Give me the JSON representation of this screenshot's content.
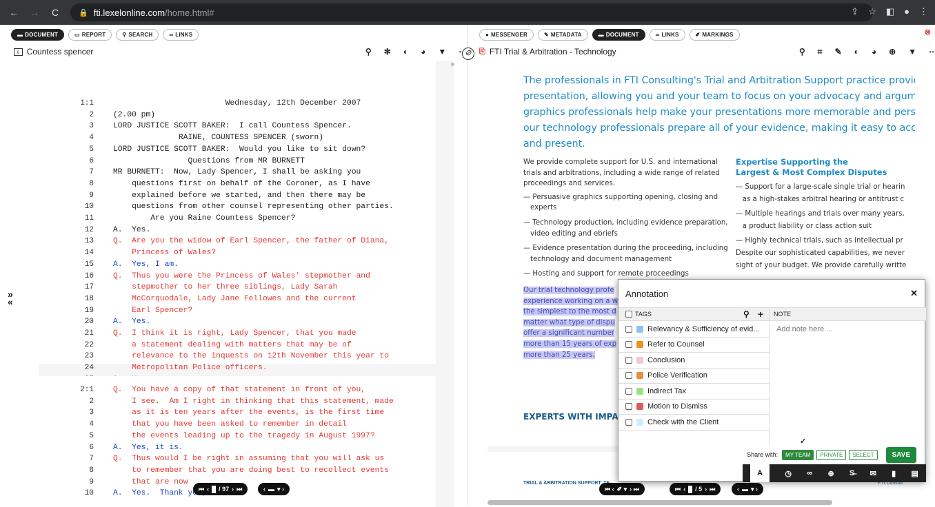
{
  "browser": {
    "url_host": "fti.lexelonline.com",
    "url_path": "/home.html#",
    "back": "←",
    "forward": "→",
    "reload": "C"
  },
  "left": {
    "tabs": [
      {
        "label": "DOCUMENT",
        "icon": "▬"
      },
      {
        "label": "REPORT",
        "icon": "▭"
      },
      {
        "label": "SEARCH",
        "icon": "⚲"
      },
      {
        "label": "LINKS",
        "icon": "∞"
      }
    ],
    "title": "Countess spencer",
    "page1": [
      {
        "n": "1:1",
        "t": "                        Wednesday, 12th December 2007",
        "c": ""
      },
      {
        "n": "2",
        "t": "(2.00 pm)",
        "c": ""
      },
      {
        "n": "3",
        "t": "LORD JUSTICE SCOTT BAKER:  I call Countess Spencer.",
        "c": ""
      },
      {
        "n": "4",
        "t": "              RAINE, COUNTESS SPENCER (sworn)",
        "c": ""
      },
      {
        "n": "5",
        "t": "LORD JUSTICE SCOTT BAKER:  Would you like to sit down?",
        "c": ""
      },
      {
        "n": "6",
        "t": "                Questions from MR BURNETT",
        "c": ""
      },
      {
        "n": "7",
        "t": "MR BURNETT:  Now, Lady Spencer, I shall be asking you",
        "c": ""
      },
      {
        "n": "8",
        "t": "    questions first on behalf of the Coroner, as I have",
        "c": ""
      },
      {
        "n": "9",
        "t": "    explained before we started, and then there may be",
        "c": ""
      },
      {
        "n": "10",
        "t": "    questions from other counsel representing other parties.",
        "c": ""
      },
      {
        "n": "11",
        "t": "        Are you Raine Countess Spencer?",
        "c": ""
      },
      {
        "n": "12",
        "t": "A.  Yes.",
        "c": ""
      },
      {
        "n": "13",
        "t": "Q.  Are you the widow of Earl Spencer, the father of Diana,",
        "c": "red"
      },
      {
        "n": "14",
        "t": "    Princess of Wales?",
        "c": "red"
      },
      {
        "n": "15",
        "t": "A.  Yes, I am.",
        "c": "blue"
      },
      {
        "n": "16",
        "t": "Q.  Thus you were the Princess of Wales' stepmother and",
        "c": "red"
      },
      {
        "n": "17",
        "t": "    stepmother to her three siblings, Lady Sarah",
        "c": "red"
      },
      {
        "n": "18",
        "t": "    McCorquodale, Lady Jane Fellowes and the current",
        "c": "red"
      },
      {
        "n": "19",
        "t": "    Earl Spencer?",
        "c": "red"
      },
      {
        "n": "20",
        "t": "A.  Yes.",
        "c": "blue"
      },
      {
        "n": "21",
        "t": "Q.  I think it is right, Lady Spencer, that you made",
        "c": "red"
      },
      {
        "n": "22",
        "t": "    a statement dealing with matters that may be of",
        "c": "red"
      },
      {
        "n": "23",
        "t": "    relevance to the inquests on 12th November this year to",
        "c": "red"
      },
      {
        "n": "24",
        "t": "    Metropolitan Police officers.",
        "c": "red"
      },
      {
        "n": "25",
        "t": "A.  Yes.",
        "c": "blue"
      }
    ],
    "page2": [
      {
        "n": "2:1",
        "t": "Q.  You have a copy of that statement in front of you,",
        "c": "red"
      },
      {
        "n": "2",
        "t": "    I see.  Am I right in thinking that this statement, made",
        "c": "red"
      },
      {
        "n": "3",
        "t": "    as it is ten years after the events, is the first time",
        "c": "red"
      },
      {
        "n": "4",
        "t": "    that you have been asked to remember in detail",
        "c": "red"
      },
      {
        "n": "5",
        "t": "    the events leading up to the tragedy in August 1997?",
        "c": "red"
      },
      {
        "n": "6",
        "t": "A.  Yes, it is.",
        "c": "blue"
      },
      {
        "n": "7",
        "t": "Q.  Thus would I be right in assuming that you will ask us",
        "c": "red"
      },
      {
        "n": "8",
        "t": "    to remember that you are doing best to recollect events",
        "c": "red"
      },
      {
        "n": "9",
        "t": "    that are now",
        "c": "red"
      },
      {
        "n": "10",
        "t": "A.  Yes.  Thank you, sir.",
        "c": "blue"
      }
    ],
    "pager": "/ 97",
    "side_arrows": [
      "»",
      "«"
    ]
  },
  "right": {
    "tabs": [
      {
        "label": "MESSENGER",
        "icon": "●"
      },
      {
        "label": "METADATA",
        "icon": "✎"
      },
      {
        "label": "DOCUMENT",
        "icon": "▬"
      },
      {
        "label": "LINKS",
        "icon": "∞"
      },
      {
        "label": "MARKINGS",
        "icon": "✐"
      }
    ],
    "title": "FTI Trial & Arbitration - Technology",
    "intro": [
      "The professionals in FTI Consulting's Trial and Arbitration Support practice provide a sea",
      "presentation, allowing you and your team to focus on your advocacy and argument. Our",
      "graphics professionals help make your presentations more memorable and persuasive, w",
      "our technology professionals prepare all of your evidence, making it easy to access, revie",
      "and present."
    ],
    "col1_p": "We provide complete support for U.S. and international trials and arbitrations, including a wide range of related proceedings and services.",
    "col1_bullets": [
      "— Persuasive graphics supporting opening, closing and experts",
      "— Technology production, including evidence preparation, video editing and ebriefs",
      "— Evidence presentation during the proceeding, including technology and document management",
      "— Hosting and support for remote proceedings"
    ],
    "col1_hl": [
      "Our trial technology profe",
      "experience working on a w",
      "the simplest to the most d",
      "matter what type of dispu",
      "offer a significant number",
      "more than 15 years of exp",
      "more than 25 years."
    ],
    "col2_h": [
      "Expertise Supporting the",
      "Largest & Most Complex Disputes"
    ],
    "col2_lines": [
      "— Support for a large-scale single trial or hearin",
      "   as a high-stakes arbitral hearing or antitrust c",
      "— Multiple hearings and trials over many years,",
      "   a product liability or class action suit",
      "— Highly technical trials, such as intellectual pr",
      "Despite our sophisticated capabilities, we never",
      "sight of your budget. We provide carefully writte"
    ],
    "experts": "EXPERTS WITH IMPACT",
    "footer_left": "TRIAL & ARBITRATION SUPPORT: TE",
    "footer_right": "FTI Consult",
    "pager": "/ 5",
    "close": "⊗"
  },
  "annotation": {
    "title": "Annotation",
    "tags_header": "TAGS",
    "note_header": "NOTE",
    "note_placeholder": "Add note here ...",
    "tags": [
      {
        "label": "Relevancy & Sufficiency of evid...",
        "color": "#90c1f0"
      },
      {
        "label": "Refer to Counsel",
        "color": "#f0901e"
      },
      {
        "label": "Conclusion",
        "color": "#f2c7d6"
      },
      {
        "label": "Police Verification",
        "color": "#e8903a"
      },
      {
        "label": "Indirect Tax",
        "color": "#9be27f"
      },
      {
        "label": "Motion to Dismiss",
        "color": "#e05a5a"
      },
      {
        "label": "Check with the Client",
        "color": "#cdeef7"
      }
    ],
    "share_label": "Share with:",
    "share_opts": [
      "MY TEAM",
      "PRIVATE",
      "SELECT"
    ],
    "save": "SAVE",
    "check": "✓"
  }
}
